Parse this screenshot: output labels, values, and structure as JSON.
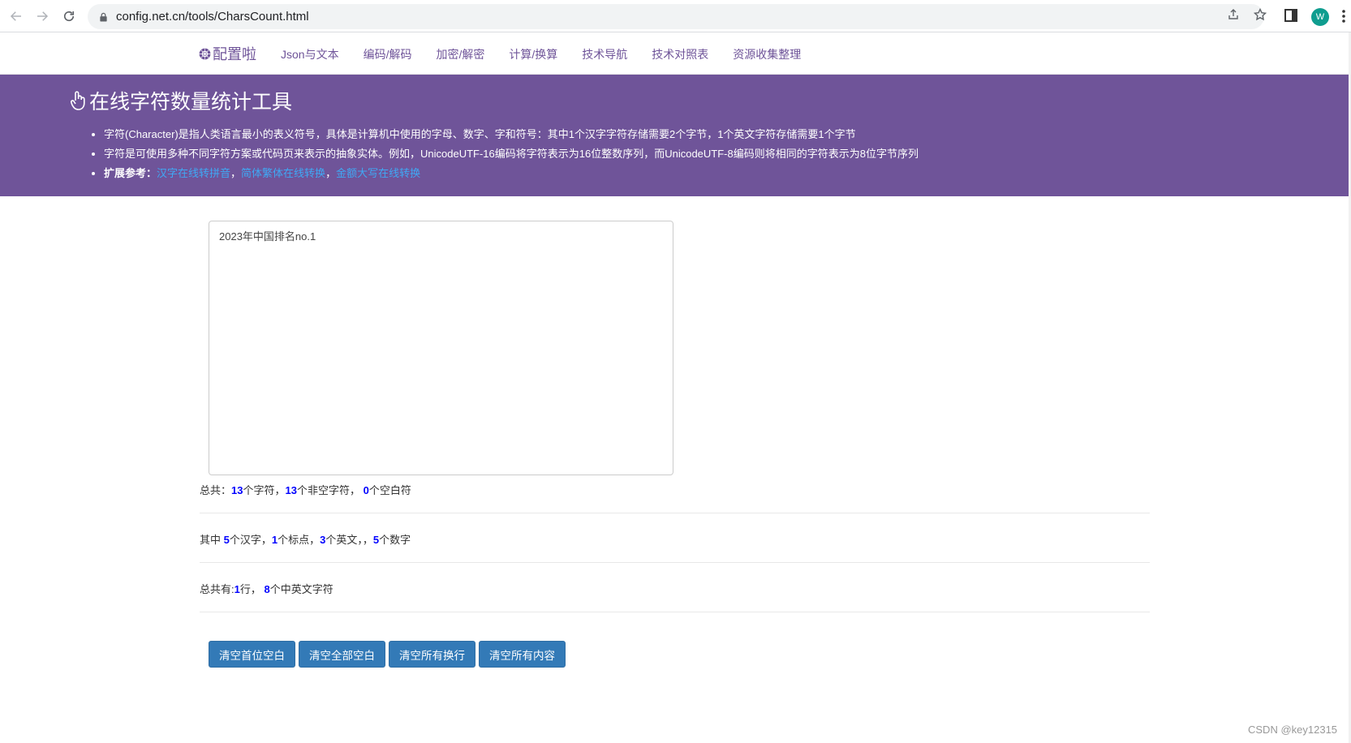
{
  "browser": {
    "url": "config.net.cn/tools/CharsCount.html",
    "avatar_letter": "W"
  },
  "nav": {
    "brand": "配置啦",
    "links": [
      "Json与文本",
      "编码/解码",
      "加密/解密",
      "计算/换算",
      "技术导航",
      "技术对照表",
      "资源收集整理"
    ]
  },
  "hero": {
    "title": "在线字符数量统计工具",
    "bullet1": "字符(Character)是指人类语言最小的表义符号，具体是计算机中使用的字母、数字、字和符号：其中1个汉字字符存储需要2个字节，1个英文字符存储需要1个字节",
    "bullet2": "字符是可使用多种不同字符方案或代码页来表示的抽象实体。例如，UnicodeUTF-16编码将字符表示为16位整数序列，而UnicodeUTF-8编码则将相同的字符表示为8位字节序列",
    "ext_label": "扩展参考：",
    "link1": "汉字在线转拼音",
    "link2": "简体繁体在线转换",
    "link3": "金额大写在线转换",
    "sep": "，"
  },
  "editor": {
    "value": "2023年中国排名no.1"
  },
  "stats": {
    "row1": {
      "prefix": "总共：",
      "total_chars": "13",
      "t1": "个字符，",
      "non_space": "13",
      "t2": "个非空字符， ",
      "spaces": "0",
      "t3": "个空白符"
    },
    "row2": {
      "prefix": "其中 ",
      "hanzi": "5",
      "t1": "个汉字，",
      "punct": "1",
      "t2": "个标点，",
      "english": "3",
      "t3": "个英文，，",
      "digits": "5",
      "t4": "个数字"
    },
    "row3": {
      "prefix": "总共有:",
      "lines": "1",
      "t1": "行， ",
      "mixed": "8",
      "t2": "个中英文字符"
    }
  },
  "buttons": [
    "清空首位空白",
    "清空全部空白",
    "清空所有换行",
    "清空所有内容"
  ],
  "watermark": "CSDN @key12315",
  "colors": {
    "brand_purple": "#6f5499",
    "button_blue": "#337ab7",
    "link_blue": "#3fa9f5",
    "stat_number": "#0000ff"
  }
}
